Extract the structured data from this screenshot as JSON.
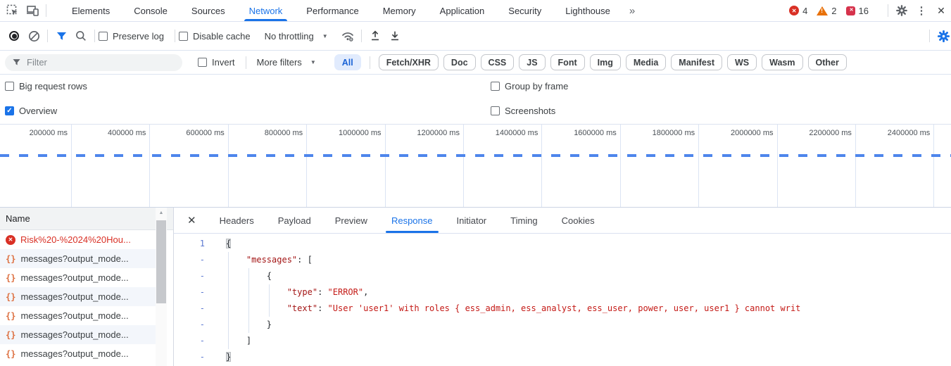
{
  "icons": {
    "x": "✕",
    "check": "✓",
    "more_tabs": "»",
    "kebab": "⋮",
    "close": "✕",
    "dropdown": "▼",
    "warning_mark": "!",
    "scroll_up": "▲",
    "xhr": "{}"
  },
  "colors": {
    "accent": "#1a73e8",
    "error": "#d93025",
    "warning": "#e8710a",
    "issue": "#d6334c",
    "xhr_icon": "#dd6f3f",
    "code_key": "#a31515",
    "code_string": "#c41a16"
  },
  "tabbar": {
    "tabs": [
      {
        "label": "Elements"
      },
      {
        "label": "Console"
      },
      {
        "label": "Sources"
      },
      {
        "label": "Network",
        "active": true
      },
      {
        "label": "Performance"
      },
      {
        "label": "Memory"
      },
      {
        "label": "Application"
      },
      {
        "label": "Security"
      },
      {
        "label": "Lighthouse"
      }
    ],
    "badges": {
      "errors": "4",
      "warnings": "2",
      "issues": "16"
    }
  },
  "toolbar": {
    "preserve_log": "Preserve log",
    "disable_cache": "Disable cache",
    "throttling": "No throttling"
  },
  "filterbar": {
    "placeholder": "Filter",
    "invert": "Invert",
    "more_filters": "More filters",
    "chips": [
      {
        "label": "All",
        "active": true
      },
      {
        "label": "Fetch/XHR"
      },
      {
        "label": "Doc"
      },
      {
        "label": "CSS"
      },
      {
        "label": "JS"
      },
      {
        "label": "Font"
      },
      {
        "label": "Img"
      },
      {
        "label": "Media"
      },
      {
        "label": "Manifest"
      },
      {
        "label": "WS"
      },
      {
        "label": "Wasm"
      },
      {
        "label": "Other"
      }
    ]
  },
  "options": {
    "big_request_rows": "Big request rows",
    "group_by_frame": "Group by frame",
    "overview": "Overview",
    "screenshots": "Screenshots"
  },
  "timeline": {
    "ticks": [
      "200000 ms",
      "400000 ms",
      "600000 ms",
      "800000 ms",
      "1000000 ms",
      "1200000 ms",
      "1400000 ms",
      "1600000 ms",
      "1800000 ms",
      "2000000 ms",
      "2200000 ms",
      "2400000 ms"
    ]
  },
  "requests": {
    "column_header": "Name",
    "rows": [
      {
        "type": "error",
        "label": "Risk%20-%2024%20Hou..."
      },
      {
        "type": "xhr",
        "label": "messages?output_mode..."
      },
      {
        "type": "xhr",
        "label": "messages?output_mode..."
      },
      {
        "type": "xhr",
        "label": "messages?output_mode..."
      },
      {
        "type": "xhr",
        "label": "messages?output_mode..."
      },
      {
        "type": "xhr",
        "label": "messages?output_mode..."
      },
      {
        "type": "xhr",
        "label": "messages?output_mode..."
      }
    ]
  },
  "detail": {
    "tabs": [
      {
        "label": "Headers"
      },
      {
        "label": "Payload"
      },
      {
        "label": "Preview"
      },
      {
        "label": "Response",
        "active": true
      },
      {
        "label": "Initiator"
      },
      {
        "label": "Timing"
      },
      {
        "label": "Cookies"
      }
    ]
  },
  "response": {
    "lines": [
      {
        "num": "1",
        "ind": 0,
        "tokens": [
          {
            "c": "p",
            "v": "{",
            "hl": true
          }
        ]
      },
      {
        "num": "-",
        "ind": 4,
        "tokens": [
          {
            "c": "key",
            "v": "\"messages\""
          },
          {
            "c": "p",
            "v": ": ["
          }
        ]
      },
      {
        "num": "-",
        "ind": 8,
        "tokens": [
          {
            "c": "p",
            "v": "{"
          }
        ]
      },
      {
        "num": "-",
        "ind": 12,
        "tokens": [
          {
            "c": "key",
            "v": "\"type\""
          },
          {
            "c": "p",
            "v": ": "
          },
          {
            "c": "str",
            "v": "\"ERROR\""
          },
          {
            "c": "p",
            "v": ","
          }
        ]
      },
      {
        "num": "-",
        "ind": 12,
        "tokens": [
          {
            "c": "key",
            "v": "\"text\""
          },
          {
            "c": "p",
            "v": ": "
          },
          {
            "c": "str",
            "v": "\"User 'user1' with roles { ess_admin, ess_analyst, ess_user, power, user, user1 } cannot writ"
          }
        ]
      },
      {
        "num": "-",
        "ind": 8,
        "tokens": [
          {
            "c": "p",
            "v": "}"
          }
        ]
      },
      {
        "num": "-",
        "ind": 4,
        "tokens": [
          {
            "c": "p",
            "v": "]"
          }
        ]
      },
      {
        "num": "-",
        "ind": 0,
        "tokens": [
          {
            "c": "p",
            "v": "}",
            "hl": true
          }
        ]
      }
    ]
  }
}
